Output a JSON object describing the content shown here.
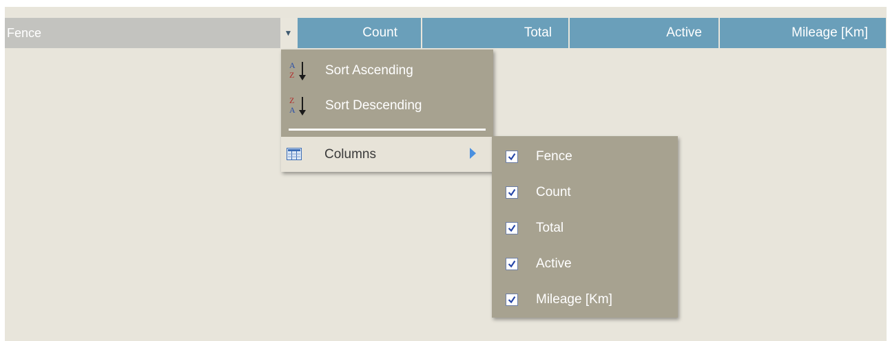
{
  "grid": {
    "columns": [
      {
        "label": "Fence"
      },
      {
        "label": "Count"
      },
      {
        "label": "Total"
      },
      {
        "label": "Active"
      },
      {
        "label": "Mileage [Km]"
      }
    ]
  },
  "column_menu": {
    "sort_ascending": "Sort Ascending",
    "sort_descending": "Sort Descending",
    "columns": "Columns"
  },
  "columns_submenu": {
    "items": [
      {
        "label": "Fence",
        "checked": true
      },
      {
        "label": "Count",
        "checked": true
      },
      {
        "label": "Total",
        "checked": true
      },
      {
        "label": "Active",
        "checked": true
      },
      {
        "label": "Mileage [Km]",
        "checked": true
      }
    ]
  },
  "colors": {
    "header_bg": "#6a9fba",
    "header_sorted_bg": "#c3c3bf",
    "grid_bg": "#e8e5db",
    "menu_bg": "#a7a290",
    "menu_highlight_bg": "#e7e3d8"
  },
  "icons": {
    "dropdown": "triangle-down-icon",
    "sort_ascending": "sort-az-icon",
    "sort_descending": "sort-za-icon",
    "columns": "columns-icon",
    "submenu_arrow": "triangle-right-icon",
    "checkbox": "checkbox-checked-icon"
  }
}
